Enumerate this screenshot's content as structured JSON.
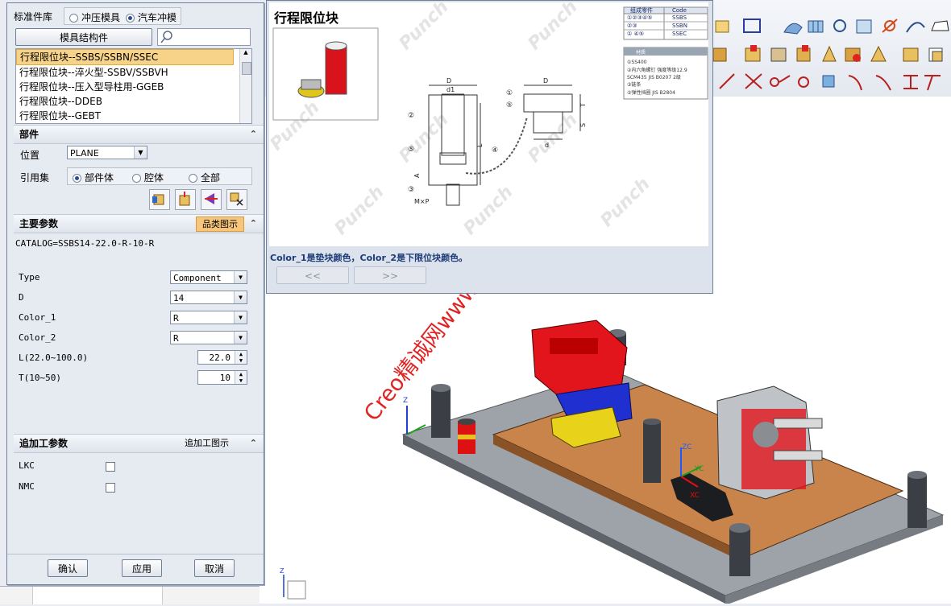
{
  "dialog": {
    "lib_label": "标准件库",
    "lib_options": [
      "冲压模具",
      "汽车冲模"
    ],
    "lib_selected": 1,
    "struct_button": "模具结构件",
    "search_placeholder": "",
    "list_items": [
      "行程限位块--SSBS/SSBN/SSEC",
      "行程限位块--淬火型-SSBV/SSBVH",
      "行程限位块--压入型导柱用-GGEB",
      "行程限位块--DDEB",
      "行程限位块--GEBT"
    ],
    "part_section": {
      "title": "部件",
      "position_label": "位置",
      "position_value": "PLANE",
      "refset_label": "引用集",
      "refset_options": [
        "部件体",
        "腔体",
        "全部"
      ],
      "refset_selected": 0
    },
    "main_params": {
      "title": "主要参数",
      "classify_button": "品类图示",
      "catalog": "CATALOG=SSBS14-22.0-R-10-R",
      "params": [
        {
          "label": "Type",
          "value": "Component",
          "kind": "combo"
        },
        {
          "label": "D",
          "value": "14",
          "kind": "combo"
        },
        {
          "label": "Color_1",
          "value": "R",
          "kind": "combo"
        },
        {
          "label": "Color_2",
          "value": "R",
          "kind": "combo"
        },
        {
          "label": "L(22.0~100.0)",
          "value": "22.0",
          "kind": "spin"
        },
        {
          "label": "T(10~50)",
          "value": "10",
          "kind": "spin"
        }
      ]
    },
    "extra_params": {
      "title": "追加工参数",
      "link": "追加工图示",
      "checks": [
        {
          "label": "LKC",
          "checked": false
        },
        {
          "label": "NMC",
          "checked": false
        }
      ]
    },
    "buttons": {
      "ok": "确认",
      "apply": "应用",
      "cancel": "取消"
    }
  },
  "preview": {
    "title": "行程限位块",
    "note": "Color_1是垫块颜色，Color_2是下限位块颜色。",
    "prev": "<<",
    "next": ">>",
    "table_head": [
      "组成零件",
      "Code"
    ],
    "table_rows": [
      [
        "①②③④⑤",
        "SSBS"
      ],
      [
        "②③",
        "SSBN"
      ],
      [
        "①  ④⑤",
        "SSEC"
      ]
    ],
    "material_head": "材质",
    "material_rows": [
      "①SS400",
      "②内六角螺钉  强度等级12.9",
      "SCM435  JIS B0207 2级",
      "③链条",
      "⑤弹性挡圈  JIS B2804"
    ],
    "dim_labels": [
      "D",
      "d1",
      "D",
      "d",
      "T",
      "L",
      "S",
      "A",
      "M×P"
    ],
    "callouts": [
      "①",
      "②",
      "③",
      "④",
      "⑤",
      "⑤"
    ],
    "watermark": "Punch"
  },
  "viewport": {
    "watermark": "Creo精诚网www.caxit.com",
    "axis_labels": {
      "zc": "ZC",
      "xc": "XC",
      "yc": "YC",
      "z": "Z"
    }
  },
  "colors": {
    "accent": "#2a4b8d",
    "red": "#e2141c",
    "blue": "#1f2fd0",
    "yellow": "#e8d21a",
    "wood": "#c8844b",
    "plate": "#8d9298"
  },
  "icons": [
    "square-select-icon",
    "surface-icon",
    "mesh-icon",
    "analysis-icon",
    "refresh-icon",
    "curve-icon",
    "sweep-icon",
    "extrude-icon",
    "block-icon",
    "cylinder-icon",
    "cone-icon",
    "sphere-icon",
    "trim-icon",
    "line-icon",
    "arc-icon",
    "spline-icon",
    "point-icon"
  ]
}
